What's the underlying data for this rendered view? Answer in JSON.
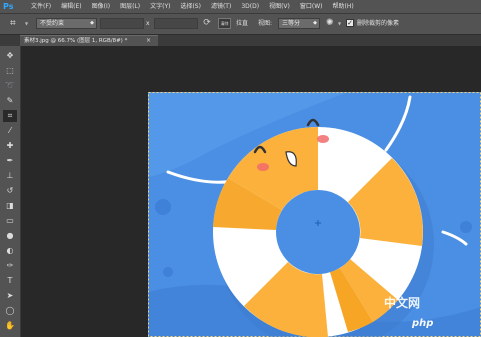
{
  "app": {
    "logo": "Ps"
  },
  "menu": [
    "文件(F)",
    "编辑(E)",
    "图像(I)",
    "图层(L)",
    "文字(Y)",
    "选择(S)",
    "滤镜(T)",
    "3D(D)",
    "视图(V)",
    "窗口(W)",
    "帮助(H)"
  ],
  "options": {
    "ratio_select": "不受约束",
    "times_sign": "x",
    "clear_label": "清除",
    "straighten_label": "拉直",
    "view_label": "视图:",
    "view_select": "三等分",
    "delete_cropped_label": "删除裁剪的像素",
    "delete_cropped_checked": true
  },
  "tab": {
    "title": "素材3.jpg @ 66.7% (图层 1, RGB/8#) *",
    "close": "×"
  },
  "tools": [
    "move-tool",
    "marquee-tool",
    "lasso-tool",
    "quick-select-tool",
    "crop-tool",
    "eyedropper-tool",
    "healing-brush-tool",
    "brush-tool",
    "clone-stamp-tool",
    "history-brush-tool",
    "eraser-tool",
    "gradient-tool",
    "blur-tool",
    "dodge-tool",
    "pen-tool",
    "type-tool",
    "path-selection-tool",
    "rectangle-tool",
    "hand-tool"
  ],
  "watermarks": {
    "php": "php",
    "cn": "中文网"
  },
  "colors": {
    "chrome": "#535353",
    "canvas_bg": "#282828",
    "artwork_blue": "#4a90e2",
    "ring_orange": "#fbb13c",
    "ring_white": "#ffffff"
  }
}
